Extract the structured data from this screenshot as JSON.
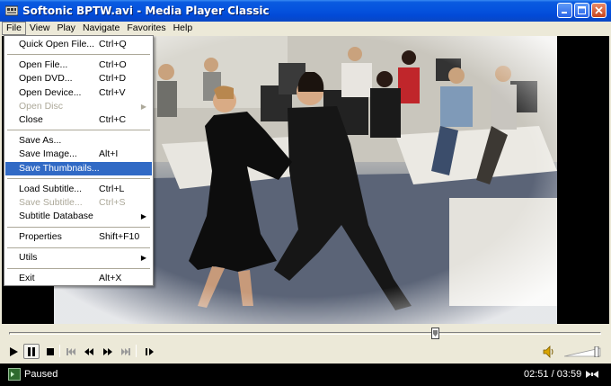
{
  "window": {
    "title": "Softonic BPTW.avi - Media Player Classic",
    "icon": "film-reel-icon",
    "buttons": [
      "minimize-icon",
      "maximize-icon",
      "close-icon"
    ]
  },
  "menubar": {
    "items": [
      {
        "label": "File",
        "active": true
      },
      {
        "label": "View"
      },
      {
        "label": "Play"
      },
      {
        "label": "Navigate"
      },
      {
        "label": "Favorites"
      },
      {
        "label": "Help"
      }
    ]
  },
  "file_menu": {
    "items": [
      {
        "type": "item",
        "label": "Quick Open File...",
        "shortcut": "Ctrl+Q"
      },
      {
        "type": "sep"
      },
      {
        "type": "item",
        "label": "Open File...",
        "shortcut": "Ctrl+O"
      },
      {
        "type": "item",
        "label": "Open DVD...",
        "shortcut": "Ctrl+D"
      },
      {
        "type": "item",
        "label": "Open Device...",
        "shortcut": "Ctrl+V"
      },
      {
        "type": "item",
        "label": "Open Disc",
        "shortcut": "",
        "disabled": true,
        "submenu": true
      },
      {
        "type": "item",
        "label": "Close",
        "shortcut": "Ctrl+C"
      },
      {
        "type": "sep"
      },
      {
        "type": "item",
        "label": "Save As...",
        "shortcut": ""
      },
      {
        "type": "item",
        "label": "Save Image...",
        "shortcut": "Alt+I"
      },
      {
        "type": "item",
        "label": "Save Thumbnails...",
        "shortcut": "",
        "highlighted": true
      },
      {
        "type": "sep"
      },
      {
        "type": "item",
        "label": "Load Subtitle...",
        "shortcut": "Ctrl+L"
      },
      {
        "type": "item",
        "label": "Save Subtitle...",
        "shortcut": "Ctrl+S",
        "disabled": true
      },
      {
        "type": "item",
        "label": "Subtitle Database",
        "shortcut": "",
        "submenu": true
      },
      {
        "type": "sep"
      },
      {
        "type": "item",
        "label": "Properties",
        "shortcut": "Shift+F10"
      },
      {
        "type": "sep"
      },
      {
        "type": "item",
        "label": "Utils",
        "shortcut": "",
        "submenu": true
      },
      {
        "type": "sep"
      },
      {
        "type": "item",
        "label": "Exit",
        "shortcut": "Alt+X"
      }
    ]
  },
  "seek": {
    "position_fraction": 0.72
  },
  "controls": {
    "buttons": [
      {
        "name": "play-icon",
        "pressed": false
      },
      {
        "name": "pause-icon",
        "pressed": true
      },
      {
        "name": "stop-icon",
        "pressed": false
      },
      {
        "name": "skip-back-icon",
        "disabled": true
      },
      {
        "name": "rewind-icon"
      },
      {
        "name": "fast-forward-icon"
      },
      {
        "name": "skip-forward-icon",
        "disabled": true
      },
      {
        "name": "frame-step-icon"
      }
    ],
    "volume_icon": "speaker-icon",
    "volume_fraction": 0.9
  },
  "status": {
    "state": "Paused",
    "time": "02:51 / 03:59",
    "icon": "status-icon"
  },
  "colors": {
    "title_bar": "#0553DE",
    "menu_highlight": "#316AC5",
    "face": "#ECE9D8",
    "status_bg": "#000000"
  }
}
